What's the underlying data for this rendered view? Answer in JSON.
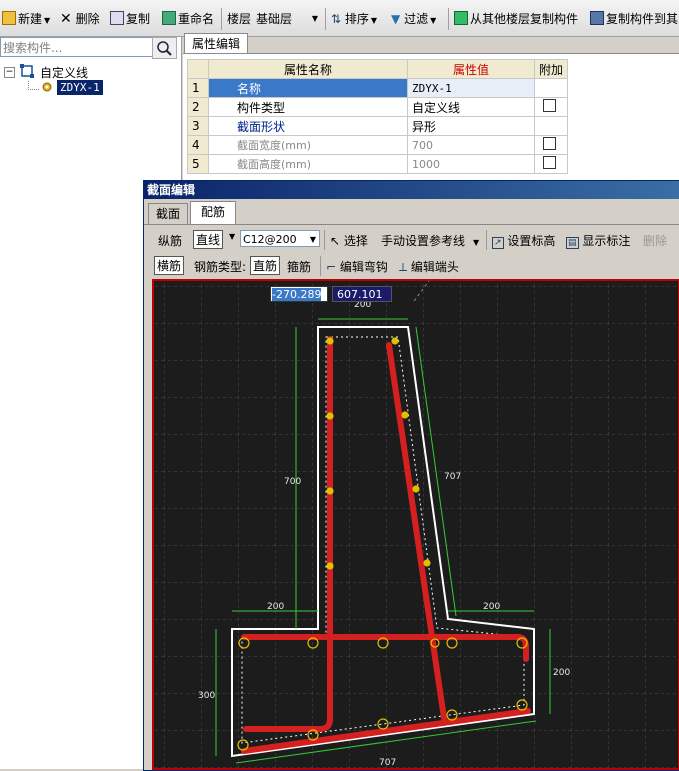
{
  "toolbar": {
    "new": "新建",
    "delete": "删除",
    "copy": "复制",
    "rename": "重命名",
    "floor_label": "楼层",
    "floor_value": "基础层",
    "sort": "排序",
    "filter": "过滤",
    "copy_from_floor": "从其他楼层复制构件",
    "copy_to": "复制构件到其"
  },
  "left_panel": {
    "search_placeholder": "搜索构件...",
    "tree": {
      "root": "自定义线",
      "child": "ZDYX-1"
    }
  },
  "property_panel": {
    "tab": "属性编辑",
    "headers": [
      "属性名称",
      "属性值",
      "附加"
    ],
    "rows": [
      {
        "num": "1",
        "name": "名称",
        "value": "ZDYX-1"
      },
      {
        "num": "2",
        "name": "构件类型",
        "value": "自定义线"
      },
      {
        "num": "3",
        "name": "截面形状",
        "value": "异形"
      },
      {
        "num": "4",
        "name": "截面宽度(mm)",
        "value": "700"
      },
      {
        "num": "5",
        "name": "截面高度(mm)",
        "value": "1000"
      }
    ]
  },
  "section_editor": {
    "title": "截面编辑",
    "tabs": [
      "截面",
      "配筋"
    ],
    "row1": {
      "longitudinal": "纵筋",
      "line_mode": "直线",
      "rebar_spec": "C12@200",
      "select": "选择",
      "manual_ref": "手动设置参考线",
      "set_elev": "设置标高",
      "show_marks": "显示标注",
      "delete": "删除"
    },
    "row2": {
      "transverse": "横筋",
      "rebar_type_label": "钢筋类型:",
      "straight": "直筋",
      "stirrup": "箍筋",
      "edit_hook": "编辑弯钩",
      "edit_end": "编辑端头"
    },
    "coords": {
      "x": "-270.289",
      "y": "607.101"
    },
    "dims": {
      "top_width": "200",
      "stem_height": "700",
      "slope": "707",
      "left_ext": "200",
      "right_ext": "200",
      "base_height": "300",
      "right_height": "200",
      "bottom": "707"
    }
  },
  "colors": {
    "canvas_bg": "#1c1c1c",
    "outline": "#ffffff",
    "rebar": "#d42020",
    "dim_line": "#33cc33",
    "rebar_dot": "#e0c000",
    "frame_border": "#c00000"
  }
}
